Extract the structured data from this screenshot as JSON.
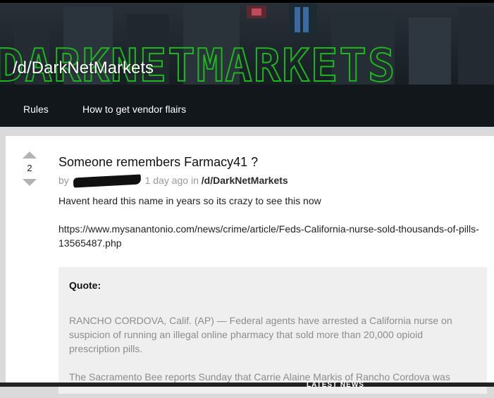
{
  "header": {
    "subreddit_title": "/d/DarkNetMarkets",
    "banner_logo_text": "DARKNETMARKETS",
    "nav": [
      {
        "label": "Rules"
      },
      {
        "label": "How to get vendor flairs"
      }
    ]
  },
  "post": {
    "score": "2",
    "title": "Someone remembers Farmacy41 ?",
    "meta_prefix": "by",
    "meta_time": "1 day ago in",
    "meta_sub": "/d/DarkNetMarkets",
    "body_line": "Havent heard this name in years so its crazy to see this now",
    "url": "https://www.mysanantonio.com/news/crime/article/Feds-California-nurse-sold-thousands-of-pills-13565487.php",
    "quote_label": "Quote:",
    "quote_paragraphs": [
      "RANCHO CORDOVA, Calif. (AP) — Federal agents have arrested a California nurse on suspicion of running an illegal online pharmacy that sold more than 20,000 opioid prescription pills.",
      "The Sacramento Bee reports Sunday that Carrie Alaine Markis of Rancho Cordova was"
    ]
  },
  "footer": {
    "latest_news": "LATEST NEWS"
  },
  "colors": {
    "banner_bg": "#141a1f",
    "logo_green": "#1db81d",
    "card_bg": "#ffffff",
    "quote_bg": "#efefef",
    "page_bg": "#dadada"
  }
}
